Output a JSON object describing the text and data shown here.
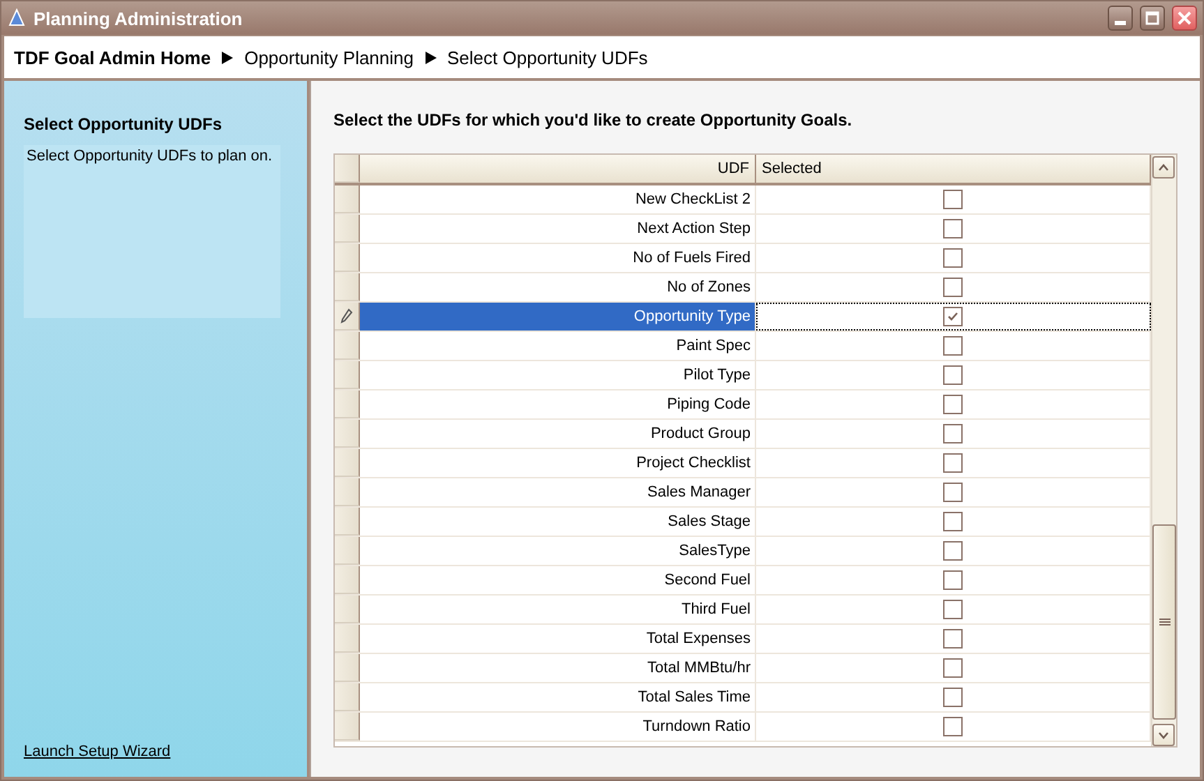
{
  "window": {
    "title": "Planning Administration"
  },
  "breadcrumb": [
    "TDF Goal Admin Home",
    "Opportunity Planning",
    "Select Opportunity UDFs"
  ],
  "sidebar": {
    "title": "Select Opportunity UDFs",
    "description": "Select Opportunity UDFs to plan on.",
    "link": "Launch Setup Wizard"
  },
  "main": {
    "heading": "Select the UDFs for which you'd like to create Opportunity Goals."
  },
  "table": {
    "columns": [
      "UDF",
      "Selected"
    ],
    "rows": [
      {
        "udf": "New CheckList 2",
        "checked": false,
        "selected": false
      },
      {
        "udf": "Next Action Step",
        "checked": false,
        "selected": false
      },
      {
        "udf": "No of Fuels Fired",
        "checked": false,
        "selected": false
      },
      {
        "udf": "No of Zones",
        "checked": false,
        "selected": false
      },
      {
        "udf": "Opportunity Type",
        "checked": true,
        "selected": true
      },
      {
        "udf": "Paint Spec",
        "checked": false,
        "selected": false
      },
      {
        "udf": "Pilot Type",
        "checked": false,
        "selected": false
      },
      {
        "udf": "Piping Code",
        "checked": false,
        "selected": false
      },
      {
        "udf": "Product Group",
        "checked": false,
        "selected": false
      },
      {
        "udf": "Project Checklist",
        "checked": false,
        "selected": false
      },
      {
        "udf": "Sales Manager",
        "checked": false,
        "selected": false
      },
      {
        "udf": "Sales Stage",
        "checked": false,
        "selected": false
      },
      {
        "udf": "SalesType",
        "checked": false,
        "selected": false
      },
      {
        "udf": "Second Fuel",
        "checked": false,
        "selected": false
      },
      {
        "udf": "Third Fuel",
        "checked": false,
        "selected": false
      },
      {
        "udf": "Total Expenses",
        "checked": false,
        "selected": false
      },
      {
        "udf": "Total MMBtu/hr",
        "checked": false,
        "selected": false
      },
      {
        "udf": "Total Sales Time",
        "checked": false,
        "selected": false
      },
      {
        "udf": "Turndown Ratio",
        "checked": false,
        "selected": false
      }
    ]
  }
}
